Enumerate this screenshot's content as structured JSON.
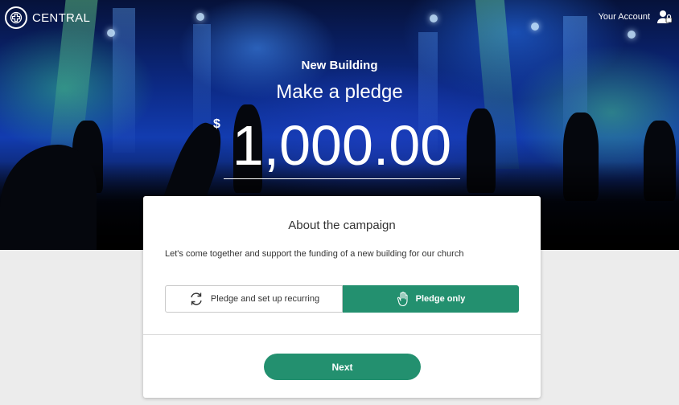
{
  "brand": {
    "name": "CENTRAL",
    "icon": "cross-circle-icon"
  },
  "header": {
    "account_label": "Your Account",
    "account_icon": "user-lock-icon"
  },
  "hero": {
    "campaign_name": "New Building",
    "heading": "Make a pledge",
    "currency_symbol": "$",
    "amount": "1,000.00"
  },
  "card": {
    "title": "About the campaign",
    "description": "Let's come together and support the funding of a new building for our church",
    "options": [
      {
        "label": "Pledge and set up recurring",
        "icon": "refresh-icon",
        "selected": false
      },
      {
        "label": "Pledge only",
        "icon": "hand-icon",
        "selected": true
      }
    ],
    "next_label": "Next"
  },
  "colors": {
    "accent": "#23906f",
    "page_bg": "#ececec"
  }
}
